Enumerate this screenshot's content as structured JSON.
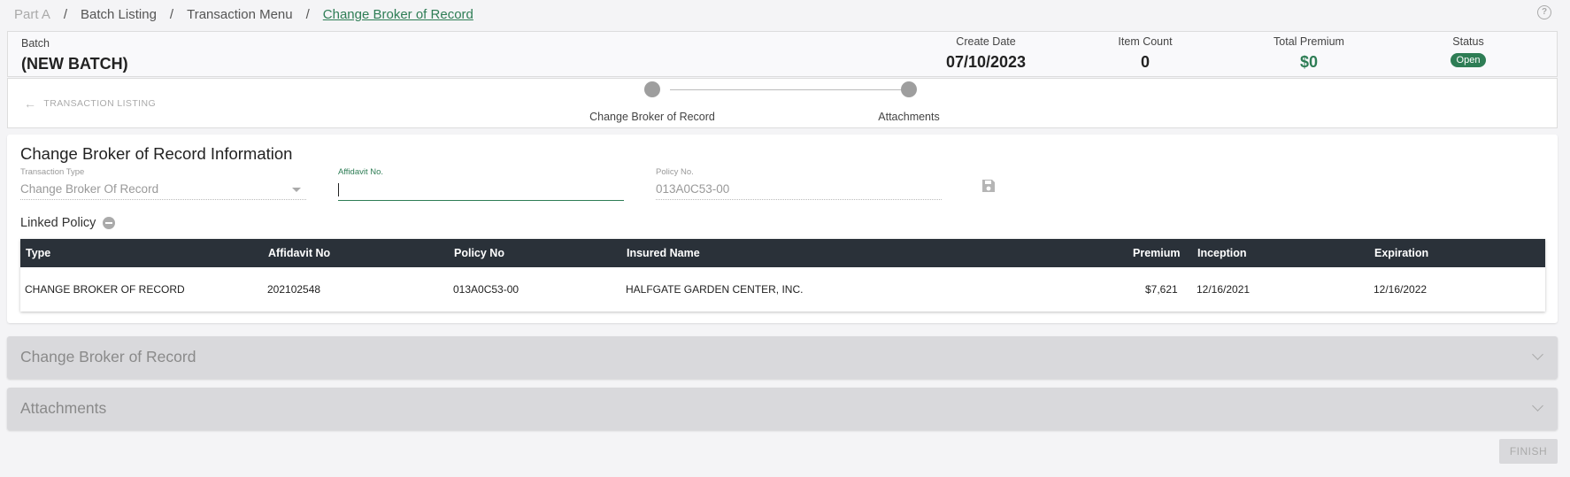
{
  "breadcrumb": {
    "items": [
      "Part A",
      "Batch Listing",
      "Transaction Menu",
      "Change Broker of Record"
    ],
    "separator": "/"
  },
  "help_icon": "?",
  "batch": {
    "label": "Batch",
    "name": "(NEW BATCH)",
    "create_date_label": "Create Date",
    "create_date": "07/10/2023",
    "item_count_label": "Item Count",
    "item_count": "0",
    "total_premium_label": "Total Premium",
    "total_premium": "$0",
    "status_label": "Status",
    "status": "Open"
  },
  "stepper": {
    "back_label": "TRANSACTION LISTING",
    "steps": [
      "Change Broker of Record",
      "Attachments"
    ]
  },
  "form": {
    "title": "Change Broker of Record Information",
    "transaction_type_label": "Transaction Type",
    "transaction_type_value": "Change Broker Of Record",
    "affidavit_label": "Affidavit No.",
    "affidavit_value": "",
    "policy_label": "Policy No.",
    "policy_value": "013A0C53-00",
    "linked_policy_label": "Linked Policy"
  },
  "table": {
    "headers": [
      "Type",
      "Affidavit No",
      "Policy No",
      "Insured Name",
      "Premium",
      "Inception",
      "Expiration"
    ],
    "rows": [
      [
        "CHANGE BROKER OF RECORD",
        "202102548",
        "013A0C53-00",
        "HALFGATE GARDEN CENTER, INC.",
        "$7,621",
        "12/16/2021",
        "12/16/2022"
      ]
    ]
  },
  "accordions": [
    "Change Broker of Record",
    "Attachments"
  ],
  "finish_button": "FINISH",
  "colors": {
    "accent": "#2e7d55",
    "table_header": "#2a3139",
    "accordion": "#d9d9dc"
  }
}
